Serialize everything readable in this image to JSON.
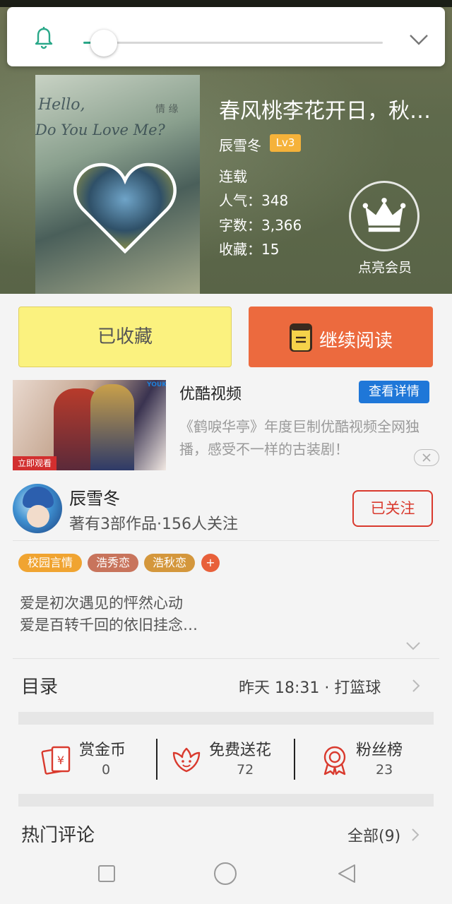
{
  "popup": {
    "bell_icon": "bell-icon",
    "slider_level_fraction": 0.06,
    "collapse_icon": "chevron-down-icon"
  },
  "book": {
    "cover_text_line1": "Hello,",
    "cover_text_line2": "Do You Love Me?",
    "cover_text_right": "情 缘",
    "title": "春风桃李花开日，秋…",
    "author": "辰雪冬",
    "level": "Lv3",
    "status": "连载",
    "popularity": "人气：348",
    "word_count": "字数：3,366",
    "favorites": "收藏：15",
    "vip_label": "点亮会员"
  },
  "actions": {
    "favorited_label": "已收藏",
    "continue_label": "继续阅读"
  },
  "ad": {
    "brand": "优酷视频",
    "detail_button": "查看详情",
    "description": "《鹤唳华亭》年度巨制优酷视频全网独播，感受不一样的古装剧！",
    "badge": "立即观看",
    "logo": "YOUKU"
  },
  "author": {
    "name": "辰雪冬",
    "meta": "著有3部作品·156人关注",
    "follow_label": "已关注"
  },
  "tags": [
    {
      "label": "校园言情",
      "color": "#f0a431"
    },
    {
      "label": "浩秀恋",
      "color": "#c8745c"
    },
    {
      "label": "浩秋恋",
      "color": "#d4973c"
    },
    {
      "label": "+",
      "color": "#e8603a"
    }
  ],
  "intro": {
    "line1": "爱是初次遇见的怦然心动",
    "line2": "爱是百转千回的依旧挂念…"
  },
  "catalog": {
    "title": "目录",
    "latest": "昨天 18:31 · 打篮球"
  },
  "stats": [
    {
      "label": "赏金币",
      "value": "0",
      "icon": "red-envelope-icon"
    },
    {
      "label": "免费送花",
      "value": "72",
      "icon": "flower-icon"
    },
    {
      "label": "粉丝榜",
      "value": "23",
      "icon": "medal-icon"
    }
  ],
  "comments": {
    "title": "热门评论",
    "all_label": "全部(9)"
  },
  "colors": {
    "accent_green": "#2aa889",
    "read_orange": "#ec6a3e",
    "fav_yellow": "#fbf27f",
    "follow_red": "#d93a2e",
    "ad_blue": "#1f77d8"
  }
}
